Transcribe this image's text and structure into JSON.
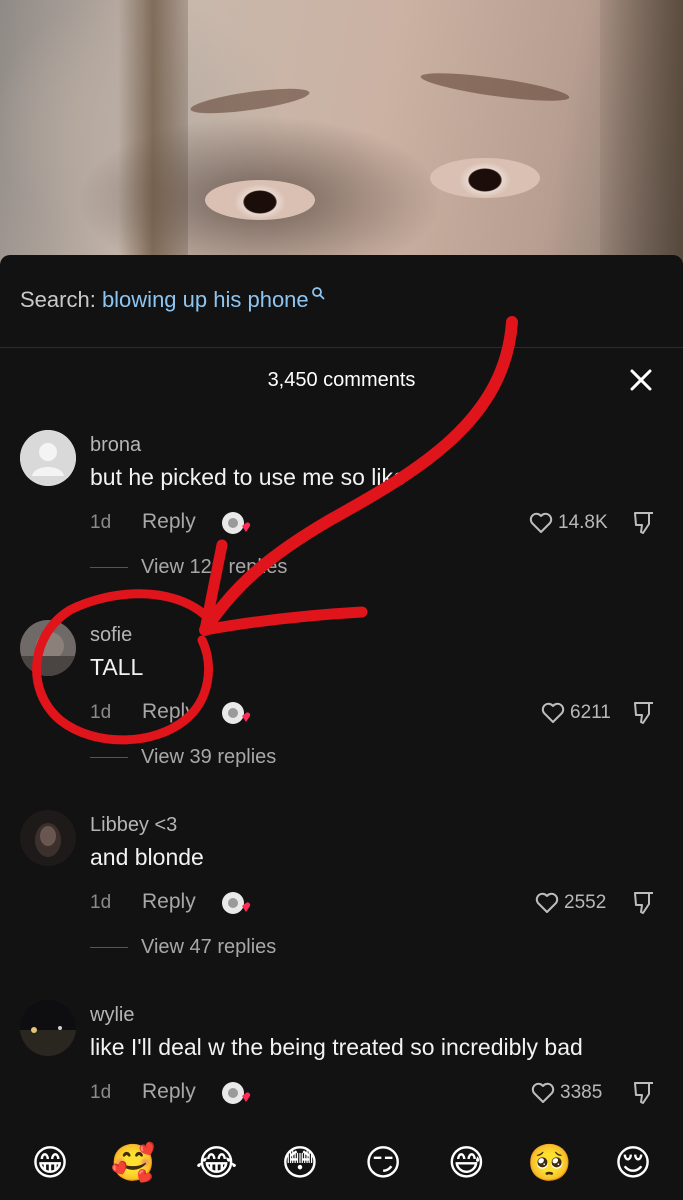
{
  "search": {
    "prefix": "Search: ",
    "term": "blowing up his phone",
    "icon": "search-icon"
  },
  "header": {
    "count_label": "3,450 comments",
    "close_icon": "close-icon"
  },
  "comments": [
    {
      "username": "brona",
      "text": "but he picked to use me so like",
      "time": "1d",
      "reply_label": "Reply",
      "likes": "14.8K",
      "view_replies": "View 120 replies",
      "avatar": "default"
    },
    {
      "username": "sofie",
      "text": "TALL",
      "time": "1d",
      "reply_label": "Reply",
      "likes": "6211",
      "view_replies": "View 39 replies",
      "avatar": "photo"
    },
    {
      "username": "Libbey <3",
      "text": "and blonde",
      "time": "1d",
      "reply_label": "Reply",
      "likes": "2552",
      "view_replies": "View 47 replies",
      "avatar": "photo"
    },
    {
      "username": "wylie",
      "text": "like I'll deal w the being treated so incredibly bad",
      "time": "1d",
      "reply_label": "Reply",
      "likes": "3385",
      "avatar": "photo"
    }
  ],
  "emoji_bar": [
    "😁",
    "🥰",
    "😂",
    "😳",
    "😏",
    "😅",
    "🥺",
    "😌"
  ],
  "colors": {
    "background": "#121212",
    "search_term": "#8ec5f0",
    "annotation": "#e0141b"
  }
}
